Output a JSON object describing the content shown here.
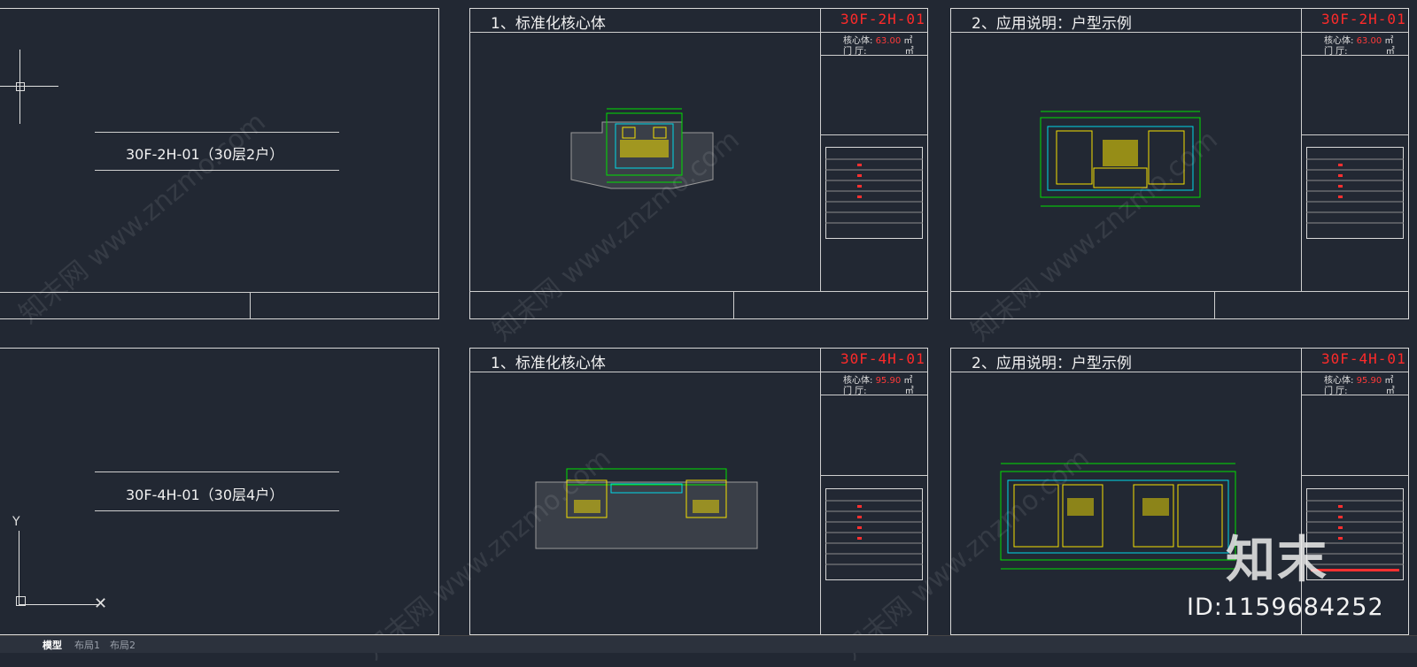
{
  "tabs": [
    {
      "label": "模型",
      "active": true
    },
    {
      "label": "布局1",
      "active": false
    },
    {
      "label": "布局2",
      "active": false
    }
  ],
  "covers": [
    {
      "label": "30F-2H-01（30层2户）"
    },
    {
      "label": "30F-4H-01（30层4户）"
    }
  ],
  "sheets": [
    {
      "title": "1、标准化核心体",
      "code": "30F-2H-01",
      "core_label": "核心体:",
      "core_value": "63.00",
      "unit": "㎡",
      "hall_label": "门   厅:",
      "hall_unit": "㎡"
    },
    {
      "title": "2、应用说明：户型示例",
      "code": "30F-2H-01",
      "core_label": "核心体:",
      "core_value": "63.00",
      "unit": "㎡",
      "hall_label": "门   厅:",
      "hall_unit": "㎡"
    },
    {
      "title": "1、标准化核心体",
      "code": "30F-4H-01",
      "core_label": "核心体:",
      "core_value": "95.90",
      "unit": "㎡",
      "hall_label": "门   厅:",
      "hall_unit": "㎡"
    },
    {
      "title": "2、应用说明：户型示例",
      "code": "30F-4H-01",
      "core_label": "核心体:",
      "core_value": "95.90",
      "unit": "㎡",
      "hall_label": "门   厅:",
      "hall_unit": "㎡"
    }
  ],
  "watermark": {
    "logo": "知末",
    "id": "ID:1159684252",
    "site": "知末网 www.znzmo.com"
  },
  "colors": {
    "background": "#222833",
    "frame": "#d9d9d9",
    "red": "#ff2a2a",
    "plan_green": "#00e000",
    "plan_yellow": "#f5e000",
    "plan_cyan": "#00d8e8"
  }
}
